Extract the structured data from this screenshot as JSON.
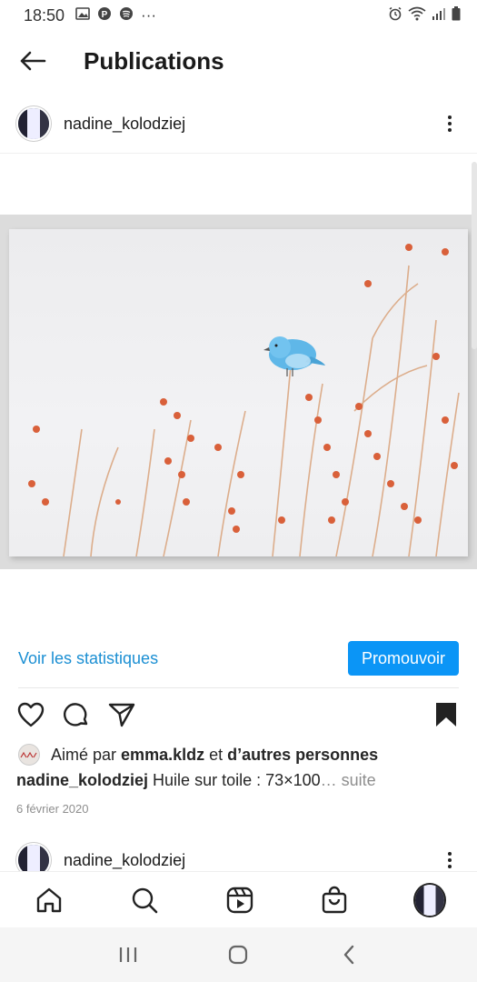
{
  "status_bar": {
    "time": "18:50",
    "more_dots": "···"
  },
  "header": {
    "title": "Publications"
  },
  "post": {
    "username": "nadine_kolodziej",
    "stats_link": "Voir les statistiques",
    "promote_label": "Promouvoir",
    "likes_prefix": "Aimé par",
    "liked_by_user": "emma.kldz",
    "likes_and": "et",
    "likes_others": "d’autres personnes",
    "caption_user": "nadine_kolodziej",
    "caption_text": "Huile sur toile : 73×100",
    "caption_more": "… suite",
    "date": "6 février 2020"
  },
  "next_post": {
    "username": "nadine_kolodziej"
  },
  "colors": {
    "accent": "#0b95f6",
    "link": "#1b8fd3"
  }
}
